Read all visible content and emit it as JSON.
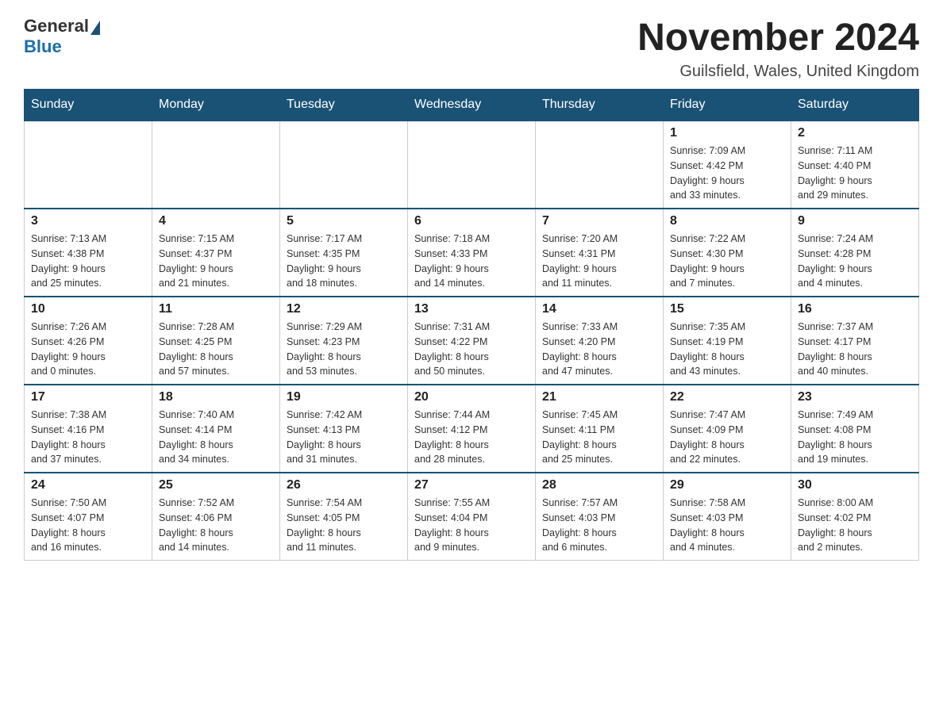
{
  "header": {
    "logo_general": "General",
    "logo_blue": "Blue",
    "month_title": "November 2024",
    "location": "Guilsfield, Wales, United Kingdom"
  },
  "weekdays": [
    "Sunday",
    "Monday",
    "Tuesday",
    "Wednesday",
    "Thursday",
    "Friday",
    "Saturday"
  ],
  "weeks": [
    [
      {
        "day": "",
        "info": ""
      },
      {
        "day": "",
        "info": ""
      },
      {
        "day": "",
        "info": ""
      },
      {
        "day": "",
        "info": ""
      },
      {
        "day": "",
        "info": ""
      },
      {
        "day": "1",
        "info": "Sunrise: 7:09 AM\nSunset: 4:42 PM\nDaylight: 9 hours\nand 33 minutes."
      },
      {
        "day": "2",
        "info": "Sunrise: 7:11 AM\nSunset: 4:40 PM\nDaylight: 9 hours\nand 29 minutes."
      }
    ],
    [
      {
        "day": "3",
        "info": "Sunrise: 7:13 AM\nSunset: 4:38 PM\nDaylight: 9 hours\nand 25 minutes."
      },
      {
        "day": "4",
        "info": "Sunrise: 7:15 AM\nSunset: 4:37 PM\nDaylight: 9 hours\nand 21 minutes."
      },
      {
        "day": "5",
        "info": "Sunrise: 7:17 AM\nSunset: 4:35 PM\nDaylight: 9 hours\nand 18 minutes."
      },
      {
        "day": "6",
        "info": "Sunrise: 7:18 AM\nSunset: 4:33 PM\nDaylight: 9 hours\nand 14 minutes."
      },
      {
        "day": "7",
        "info": "Sunrise: 7:20 AM\nSunset: 4:31 PM\nDaylight: 9 hours\nand 11 minutes."
      },
      {
        "day": "8",
        "info": "Sunrise: 7:22 AM\nSunset: 4:30 PM\nDaylight: 9 hours\nand 7 minutes."
      },
      {
        "day": "9",
        "info": "Sunrise: 7:24 AM\nSunset: 4:28 PM\nDaylight: 9 hours\nand 4 minutes."
      }
    ],
    [
      {
        "day": "10",
        "info": "Sunrise: 7:26 AM\nSunset: 4:26 PM\nDaylight: 9 hours\nand 0 minutes."
      },
      {
        "day": "11",
        "info": "Sunrise: 7:28 AM\nSunset: 4:25 PM\nDaylight: 8 hours\nand 57 minutes."
      },
      {
        "day": "12",
        "info": "Sunrise: 7:29 AM\nSunset: 4:23 PM\nDaylight: 8 hours\nand 53 minutes."
      },
      {
        "day": "13",
        "info": "Sunrise: 7:31 AM\nSunset: 4:22 PM\nDaylight: 8 hours\nand 50 minutes."
      },
      {
        "day": "14",
        "info": "Sunrise: 7:33 AM\nSunset: 4:20 PM\nDaylight: 8 hours\nand 47 minutes."
      },
      {
        "day": "15",
        "info": "Sunrise: 7:35 AM\nSunset: 4:19 PM\nDaylight: 8 hours\nand 43 minutes."
      },
      {
        "day": "16",
        "info": "Sunrise: 7:37 AM\nSunset: 4:17 PM\nDaylight: 8 hours\nand 40 minutes."
      }
    ],
    [
      {
        "day": "17",
        "info": "Sunrise: 7:38 AM\nSunset: 4:16 PM\nDaylight: 8 hours\nand 37 minutes."
      },
      {
        "day": "18",
        "info": "Sunrise: 7:40 AM\nSunset: 4:14 PM\nDaylight: 8 hours\nand 34 minutes."
      },
      {
        "day": "19",
        "info": "Sunrise: 7:42 AM\nSunset: 4:13 PM\nDaylight: 8 hours\nand 31 minutes."
      },
      {
        "day": "20",
        "info": "Sunrise: 7:44 AM\nSunset: 4:12 PM\nDaylight: 8 hours\nand 28 minutes."
      },
      {
        "day": "21",
        "info": "Sunrise: 7:45 AM\nSunset: 4:11 PM\nDaylight: 8 hours\nand 25 minutes."
      },
      {
        "day": "22",
        "info": "Sunrise: 7:47 AM\nSunset: 4:09 PM\nDaylight: 8 hours\nand 22 minutes."
      },
      {
        "day": "23",
        "info": "Sunrise: 7:49 AM\nSunset: 4:08 PM\nDaylight: 8 hours\nand 19 minutes."
      }
    ],
    [
      {
        "day": "24",
        "info": "Sunrise: 7:50 AM\nSunset: 4:07 PM\nDaylight: 8 hours\nand 16 minutes."
      },
      {
        "day": "25",
        "info": "Sunrise: 7:52 AM\nSunset: 4:06 PM\nDaylight: 8 hours\nand 14 minutes."
      },
      {
        "day": "26",
        "info": "Sunrise: 7:54 AM\nSunset: 4:05 PM\nDaylight: 8 hours\nand 11 minutes."
      },
      {
        "day": "27",
        "info": "Sunrise: 7:55 AM\nSunset: 4:04 PM\nDaylight: 8 hours\nand 9 minutes."
      },
      {
        "day": "28",
        "info": "Sunrise: 7:57 AM\nSunset: 4:03 PM\nDaylight: 8 hours\nand 6 minutes."
      },
      {
        "day": "29",
        "info": "Sunrise: 7:58 AM\nSunset: 4:03 PM\nDaylight: 8 hours\nand 4 minutes."
      },
      {
        "day": "30",
        "info": "Sunrise: 8:00 AM\nSunset: 4:02 PM\nDaylight: 8 hours\nand 2 minutes."
      }
    ]
  ]
}
